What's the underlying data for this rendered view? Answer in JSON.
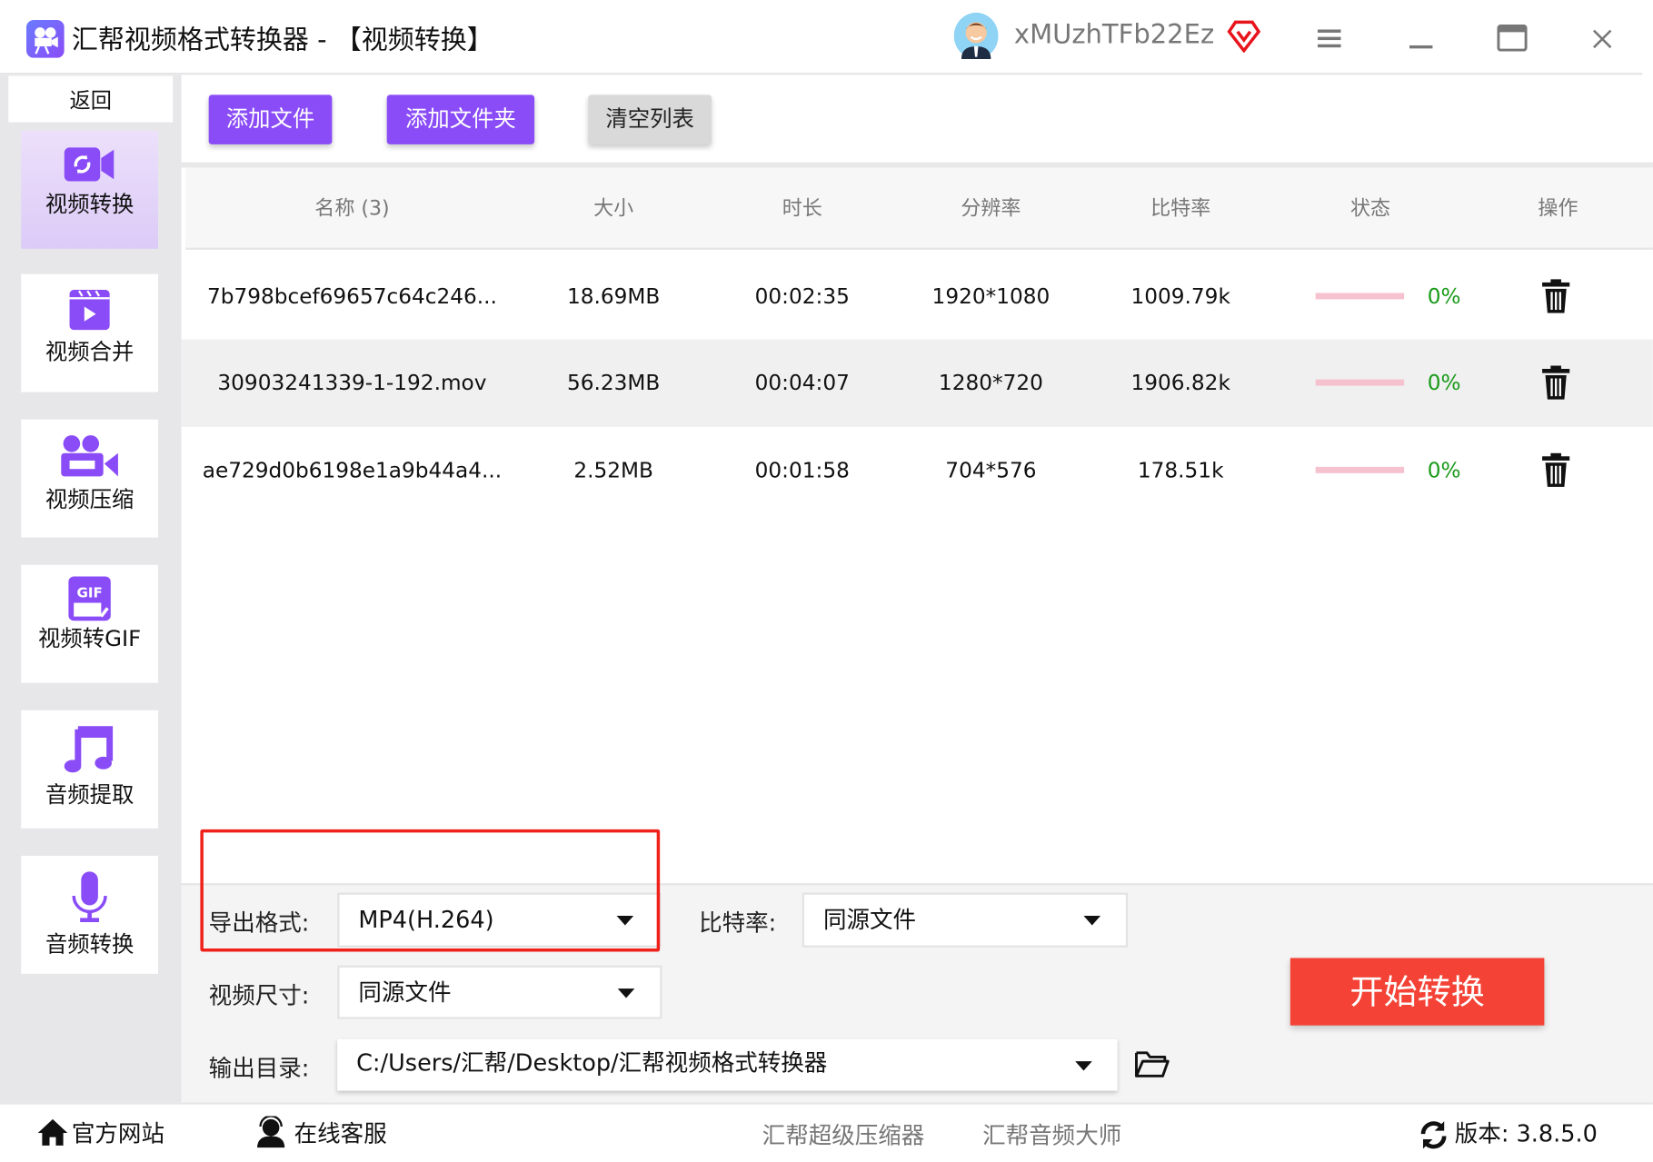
{
  "app": {
    "title": "汇帮视频格式转换器  - 【视频转换】",
    "username": "xMUzhTFb22Ez"
  },
  "colors": {
    "accent": "#8a4cf7",
    "start": "#f44336",
    "progress": "#f6c2d0",
    "percent": "#1a9a1a",
    "highlight": "#f0211b"
  },
  "sidebar": {
    "back": "返回",
    "items": [
      {
        "label": "视频转换",
        "icon": "video-convert-icon",
        "selected": true
      },
      {
        "label": "视频合并",
        "icon": "video-merge-icon"
      },
      {
        "label": "视频压缩",
        "icon": "video-compress-icon"
      },
      {
        "label": "视频转GIF",
        "icon": "gif-icon"
      },
      {
        "label": "音频提取",
        "icon": "music-note-icon"
      },
      {
        "label": "音频转换",
        "icon": "microphone-icon"
      }
    ]
  },
  "toolbar": {
    "add_file": "添加文件",
    "add_folder": "添加文件夹",
    "clear": "清空列表"
  },
  "table": {
    "headers": [
      "名称 (3)",
      "大小",
      "时长",
      "分辨率",
      "比特率",
      "状态",
      "操作"
    ],
    "rows": [
      {
        "name": "7b798bcef69657c64c246...",
        "size": "18.69MB",
        "duration": "00:02:35",
        "resolution": "1920*1080",
        "bitrate": "1009.79k",
        "progress": "0%"
      },
      {
        "name": "30903241339-1-192.mov",
        "size": "56.23MB",
        "duration": "00:04:07",
        "resolution": "1280*720",
        "bitrate": "1906.82k",
        "progress": "0%"
      },
      {
        "name": "ae729d0b6198e1a9b44a4...",
        "size": "2.52MB",
        "duration": "00:01:58",
        "resolution": "704*576",
        "bitrate": "178.51k",
        "progress": "0%"
      }
    ]
  },
  "settings": {
    "format_label": "导出格式:",
    "format_value": "MP4(H.264)",
    "bitrate_label": "比特率:",
    "bitrate_value": "同源文件",
    "size_label": "视频尺寸:",
    "size_value": "同源文件",
    "output_label": "输出目录:",
    "output_value": "C:/Users/汇帮/Desktop/汇帮视频格式转换器",
    "start": "开始转换"
  },
  "footer": {
    "website": "官方网站",
    "support": "在线客服",
    "compressor": "汇帮超级压缩器",
    "audio": "汇帮音频大师",
    "version": "版本: 3.8.5.0"
  }
}
